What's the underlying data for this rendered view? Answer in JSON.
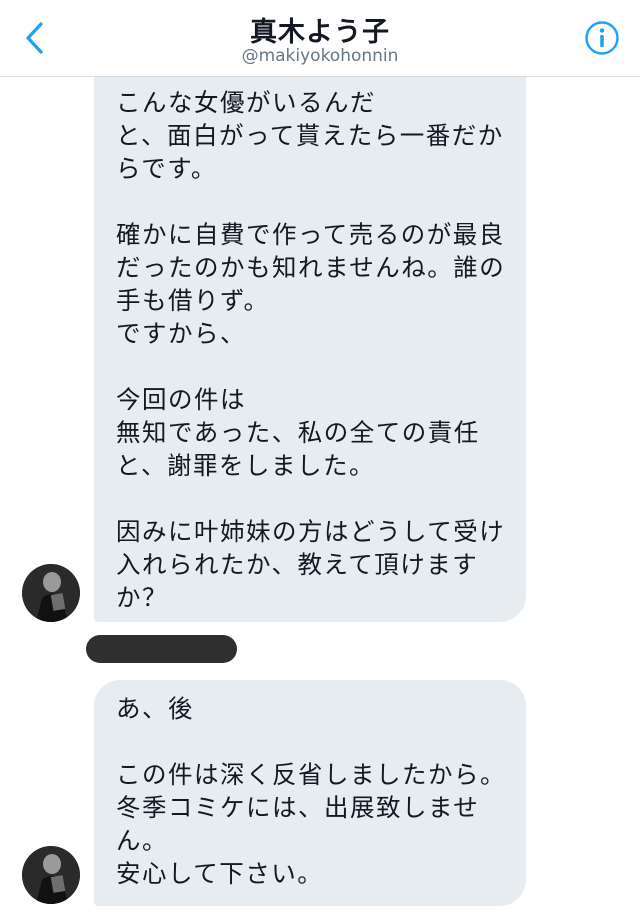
{
  "header": {
    "title": "真木よう子",
    "handle": "@makiyokohonnin",
    "back_icon": "chevron-left-icon",
    "info_icon": "info-icon",
    "accent_color": "#1da1f2"
  },
  "messages": [
    {
      "lines": [
        "こんな女優がいるんだ",
        "と、面白がって貰えたら一番だか",
        "らです。",
        "",
        "確かに自費で作って売るのが最良",
        "だったのかも知れませんね。誰の",
        "手も借りず。",
        "ですから、",
        "",
        "今回の件は",
        "無知であった、私の全ての責任",
        "と、謝罪をしました。",
        "",
        "因みに叶姉妹の方はどうして受け",
        "入れられたか、教えて頂けます",
        "か？"
      ]
    },
    {
      "lines": [
        "あ、後",
        "",
        "この件は深く反省しましたから。",
        "冬季コミケには、出展致しませ",
        "ん。",
        "安心して下さい。"
      ]
    }
  ]
}
